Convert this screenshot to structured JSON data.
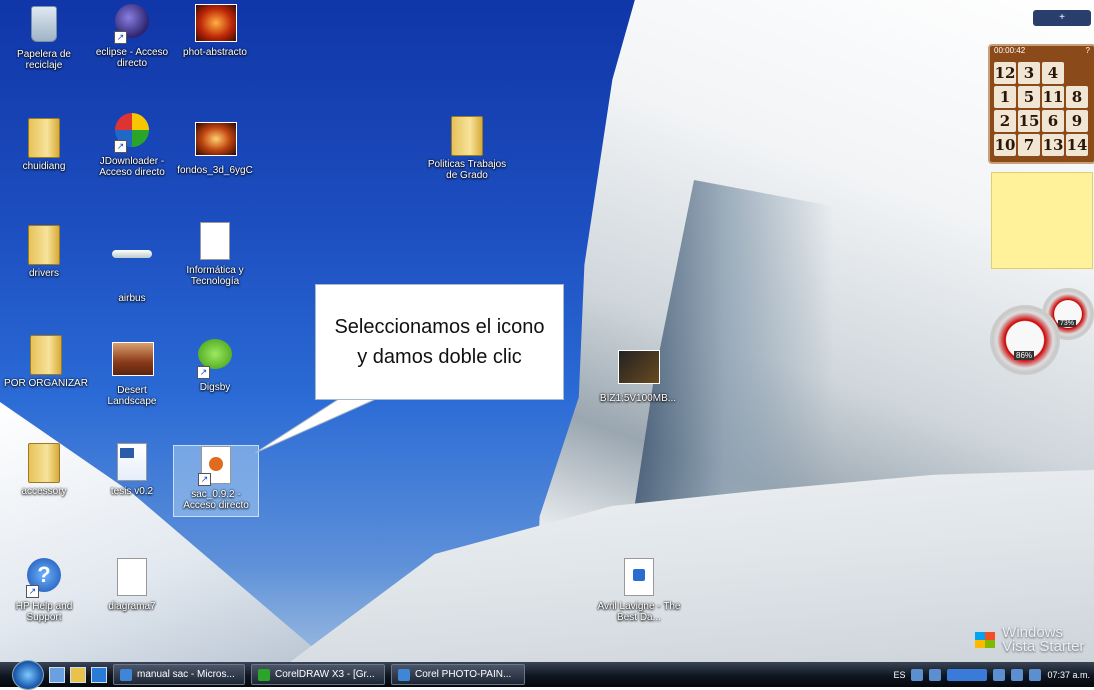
{
  "desktop": {
    "icons": [
      {
        "label": "Papelera de reciclaje"
      },
      {
        "label": "eclipse - Acceso directo"
      },
      {
        "label": "phot-abstracto"
      },
      {
        "label": "chuidiang"
      },
      {
        "label": "JDownloader - Acceso directo"
      },
      {
        "label": "fondos_3d_6ygC"
      },
      {
        "label": "Politicas Trabajos de Grado"
      },
      {
        "label": "drivers"
      },
      {
        "label": "airbus"
      },
      {
        "label": "Informática y Tecnología"
      },
      {
        "label": "POR ORGANIZAR"
      },
      {
        "label": "Desert Landscape"
      },
      {
        "label": "Digsby"
      },
      {
        "label": "BIZ1:5V100MB..."
      },
      {
        "label": "accessory"
      },
      {
        "label": "tesis v0.2"
      },
      {
        "label": "sac_0.9.2 - Acceso directo"
      },
      {
        "label": "HP Help and Support"
      },
      {
        "label": "diagrama7"
      },
      {
        "label": "Avril Lavigne - The Best Da..."
      }
    ],
    "callout_text": "Seleccionamos el icono y damos doble clic",
    "branding": "Windows Vista Starter"
  },
  "gadgets": {
    "top_button": "+",
    "puzzle": {
      "timer": "00:00:42",
      "tiles": [
        "12",
        "3",
        "4",
        "",
        "1",
        "5",
        "11",
        "8",
        "2",
        "15",
        "6",
        "9",
        "10",
        "7",
        "13",
        "14"
      ]
    },
    "gauges": {
      "cpu": "86%",
      "ram": "73%"
    }
  },
  "taskbar": {
    "buttons": [
      "manual sac - Micros...",
      "CorelDRAW X3 - [Gr...",
      "Corel PHOTO-PAIN..."
    ],
    "language": "ES",
    "clock": "07:37 a.m."
  },
  "colors": {
    "accent": "#1d4fc0",
    "note": "#fff29a"
  }
}
